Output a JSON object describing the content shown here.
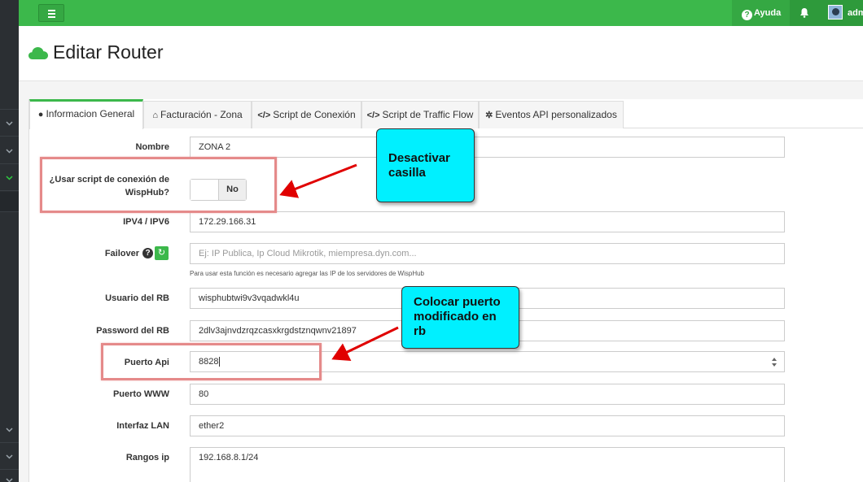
{
  "topbar": {
    "help_label": "Ayuda",
    "user_label": "admin",
    "accent": "#3cb84b"
  },
  "page": {
    "title": "Editar Router"
  },
  "tabs": [
    {
      "label": "Informacion General",
      "icon": "info-circle-icon",
      "active": true
    },
    {
      "label": "Facturación - Zona",
      "icon": "home-icon",
      "active": false
    },
    {
      "label": "Script de Conexión",
      "icon": "code-icon",
      "active": false
    },
    {
      "label": "Script de Traffic Flow",
      "icon": "code-icon",
      "active": false
    },
    {
      "label": "Eventos API personalizados",
      "icon": "gear-icon",
      "active": false
    }
  ],
  "form": {
    "nombre": {
      "label": "Nombre",
      "value": "ZONA 2"
    },
    "usar_script": {
      "label_line1": "¿Usar script de conexión de",
      "label_line2": "WispHub?",
      "value": "No"
    },
    "ip": {
      "label": "IPV4 / IPV6",
      "value": "172.29.166.31"
    },
    "failover": {
      "label": "Failover",
      "placeholder": "Ej: IP Publica, Ip Cloud Mikrotik, miempresa.dyn.com...",
      "help": "Para usar esta función es necesario agregar las IP de los servidores de WispHub"
    },
    "usuario": {
      "label": "Usuario del RB",
      "value": "wisphubtwi9v3vqadwkl4u"
    },
    "password": {
      "label": "Password del RB",
      "value": "2dlv3ajnvdzrqzcasxkrgdstznqwnv21897"
    },
    "puerto_api": {
      "label": "Puerto Api",
      "value": "8828"
    },
    "puerto_www": {
      "label": "Puerto WWW",
      "value": "80"
    },
    "interfaz_lan": {
      "label": "Interfaz LAN",
      "value": "ether2"
    },
    "rangos_ip": {
      "label": "Rangos ip",
      "value": "192.168.8.1/24"
    }
  },
  "annotations": {
    "callout1": {
      "line1": "Desactivar",
      "line2": "casilla"
    },
    "callout2": {
      "line1": "Colocar puerto",
      "line2": "modificado en",
      "line3": "rb"
    },
    "highlight_color": "#e58a8a",
    "arrow_color": "#e00000",
    "callout_color": "#00f0ff"
  }
}
